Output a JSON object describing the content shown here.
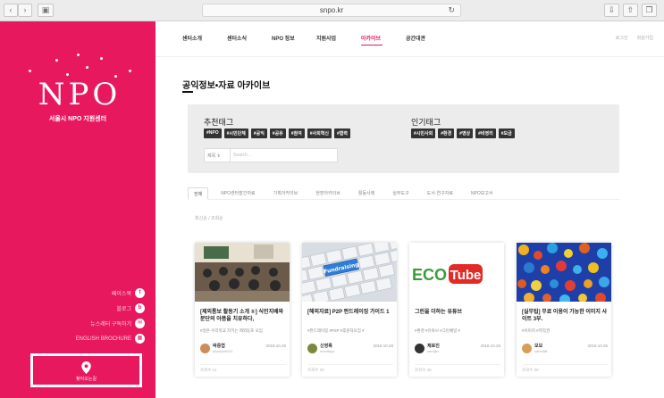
{
  "browser": {
    "url": "snpo.kr"
  },
  "sidebar": {
    "logo": "NPO",
    "center_name": "서울시 NPO 지원센터",
    "links": [
      {
        "label": "페이스북",
        "icon": "f"
      },
      {
        "label": "블로그",
        "icon": "b"
      },
      {
        "label": "뉴스레터 구독하기",
        "icon": "mail"
      },
      {
        "label": "ENGLISH BROCHURE",
        "icon": "book"
      }
    ],
    "map_label": "찾아오는길"
  },
  "topnav": {
    "menu": [
      "센터소개",
      "센터소식",
      "NPO 정보",
      "지원사업",
      "아카이브",
      "공간대관"
    ],
    "active_index": 4,
    "util": [
      "로그인",
      "회원가입"
    ]
  },
  "main": {
    "page_title": "공익정보•자료 아카이브",
    "recommended": {
      "title": "추천태그",
      "tags": [
        "#NPO",
        "#시민단체",
        "#공익",
        "#공유",
        "#참여",
        "#사회혁신",
        "#협력"
      ]
    },
    "popular": {
      "title": "인기태그",
      "tags": [
        "#시민사회",
        "#환경",
        "#영상",
        "#비영리",
        "#모금"
      ]
    },
    "search": {
      "select_value": "제목",
      "placeholder": "Search..."
    },
    "tabs": [
      "전체",
      "NPO센터발간자료",
      "기획아카이브",
      "현장아카이브",
      "활동사례",
      "실무도구",
      "도서·연구자료",
      "NPO보고서"
    ],
    "sort_text": "최신순 / 조회순"
  },
  "cards": [
    {
      "title": "[제외통보 활동기 소개 ①] 식민지배와 분단의 아픔을 치유하다,",
      "tags": "#일본·우리학교 지키는 제외동포 모임",
      "author": "박중엽",
      "handle": "docepio0911",
      "date": "2018.10.29",
      "views": "조회수 11"
    },
    {
      "title": "[해외자료] P2P 펀드레이징 가이드 1",
      "tags": "#펀드레이징 #P2P #후원자모집 #",
      "author": "신영록",
      "handle": "mondayo",
      "date": "2018.10.28",
      "views": "조회수 30"
    },
    {
      "title": "그린을 더하는 유튜브",
      "tags": "#환경 #유튜브 #그린채널 #",
      "author": "제로진",
      "handle": "zeroljin",
      "date": "2018.10.26",
      "views": "조회수 48"
    },
    {
      "title": "[실무팁] 무료 이용이 가능한 이미지 사이트 3부.",
      "tags": "#이미지 #저작권",
      "author": "모모",
      "handle": "sahrs98",
      "date": "2018.10.26",
      "views": "조회수 38"
    }
  ],
  "card_images": {
    "ecotube_text": "ECO",
    "ecotube_tube": "Tube",
    "keyboard_key": "Fundraising"
  },
  "colors": {
    "brand_pink": "#e8185f",
    "tag_dark": "#333333",
    "tagbox_bg": "#ececec"
  }
}
